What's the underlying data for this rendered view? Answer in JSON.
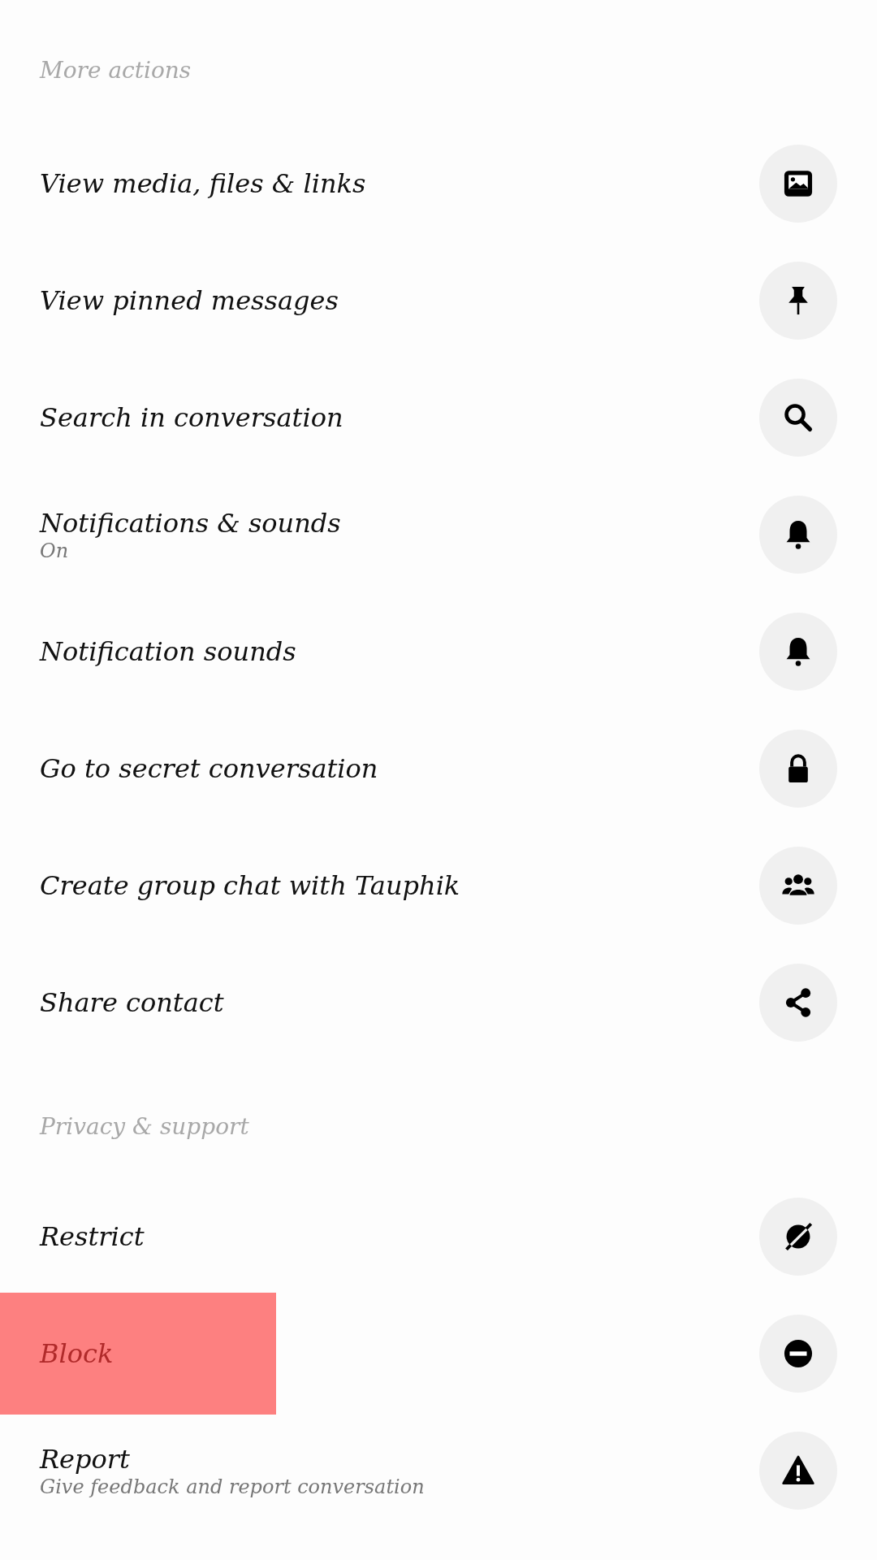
{
  "sections": [
    {
      "title": "More actions",
      "items": [
        {
          "label": "View media, files & links",
          "highlighted": false
        },
        {
          "label": "View pinned messages",
          "highlighted": false
        },
        {
          "label": "Search in conversation",
          "highlighted": false
        },
        {
          "label": "Notifications & sounds",
          "subtitle": "On",
          "highlighted": false
        },
        {
          "label": "Notification sounds",
          "highlighted": false
        },
        {
          "label": "Go to secret conversation",
          "highlighted": false
        },
        {
          "label": "Create group chat with Tauphik",
          "highlighted": false
        },
        {
          "label": "Share contact",
          "highlighted": false
        }
      ]
    },
    {
      "title": "Privacy & support",
      "items": [
        {
          "label": "Restrict",
          "highlighted": false
        },
        {
          "label": "Block",
          "highlighted": true
        },
        {
          "label": "Report",
          "subtitle": "Give feedback and report conversation",
          "highlighted": false
        }
      ]
    }
  ]
}
